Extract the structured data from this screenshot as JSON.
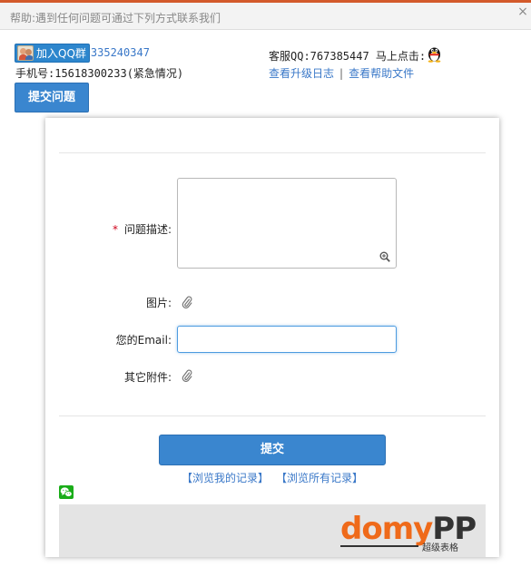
{
  "window": {
    "title": "帮助:遇到任何问题可通过下列方式联系我们",
    "close_symbol": "×"
  },
  "contact": {
    "qq_group_label": "加入QQ群",
    "qq_group_number": "335240347",
    "phone_line": "手机号:15618300233(紧急情况)",
    "service_qq_line": "客服QQ:767385447 马上点击:",
    "upgrade_log_link": "查看升级日志",
    "separator": "|",
    "help_file_link": "查看帮助文件"
  },
  "toolbar": {
    "submit_issue_label": "提交问题"
  },
  "form": {
    "required_mark": "*",
    "description_label": "问题描述:",
    "description_value": "",
    "image_label": "图片:",
    "email_label": "您的Email:",
    "email_value": "",
    "attachment_label": "其它附件:",
    "submit_label": "提交",
    "my_records_link": "【浏览我的记录】",
    "all_records_link": "【浏览所有记录】"
  },
  "banner": {
    "logo_text_main": "domy",
    "logo_text_pp": "PP",
    "logo_tagline": "超级表格"
  },
  "icons": {
    "close": "close-icon",
    "qq_group": "qq-group-icon",
    "qq_penguin": "qq-penguin-icon",
    "zoom": "zoom-icon",
    "attach": "paperclip-icon",
    "wechat": "wechat-icon"
  },
  "colors": {
    "accent": "#3a86cf",
    "link": "#3a78c8",
    "required": "#d0021b",
    "top_border": "#d35a2b",
    "logo_orange": "#ef6a1a",
    "wechat_green": "#1aad19"
  }
}
